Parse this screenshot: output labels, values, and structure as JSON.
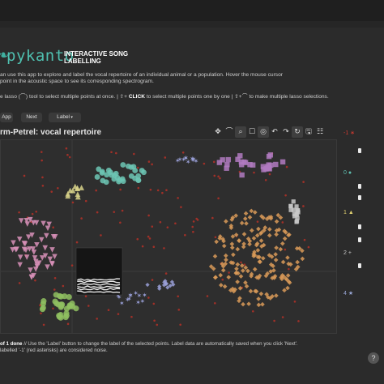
{
  "header": {
    "logo_text": "pykanto",
    "logo_glyph": "❧",
    "title_line1": "INTERACTIVE SONG",
    "title_line2": "LABELLING"
  },
  "instructions": {
    "line1": "an use this app to explore and label the vocal repertoire of an individual animal or a population. Hover the mouse cursor",
    "line2": "point in the acoustic space to see its corresponding spectrogram.",
    "line3_a": "e lasso (",
    "lasso_icon": "lasso-icon",
    "line3_b": ") tool to select multiple points at once. | ",
    "shift_symbol": "⇧",
    "plus_symbol": "+",
    "click_word": "CLICK",
    "line3_c": " to select multiple points one by one | ",
    "line3_d": " to make multiple lasso selections."
  },
  "buttons": {
    "app": "App",
    "next": "Next",
    "label": "Label"
  },
  "plot": {
    "title": "rm-Petrel: vocal repertoire"
  },
  "toolbar": [
    "move",
    "lasso",
    "zoom",
    "box-zoom",
    "wheel-zoom",
    "undo",
    "redo",
    "reset",
    "save",
    "hover"
  ],
  "legend": [
    {
      "label": "-1",
      "symbol": "∗",
      "color": "#d03a30"
    },
    {
      "label": "0",
      "symbol": "●",
      "color": "#5fbfb0"
    },
    {
      "label": "1",
      "symbol": "▲",
      "color": "#e0d070"
    },
    {
      "label": "2",
      "symbol": "+",
      "color": "#c8c8c8"
    },
    {
      "label": "4",
      "symbol": "★",
      "color": "#9aa8d8"
    }
  ],
  "footer": {
    "progress": "of 1 done",
    "line1_rest": " // Use the 'Label' button to change the label of the selected points. Label data are automatically saved when you click 'Next'.",
    "line2": "labelled '-1' (red asterisks) are considered noise."
  },
  "help_button": "?",
  "colors": {
    "background": "#2b2b2b",
    "accent": "#4fc0b0",
    "noise": "#a03028",
    "cluster_teal": "#6cc6b4",
    "cluster_purple": "#b07ac0",
    "cluster_orange": "#d99a58",
    "cluster_pink": "#d890b8",
    "cluster_green": "#8fc060",
    "cluster_lavender": "#9aa0d8",
    "cluster_yellow": "#d8d28a",
    "cluster_gray": "#c8c8c8"
  }
}
